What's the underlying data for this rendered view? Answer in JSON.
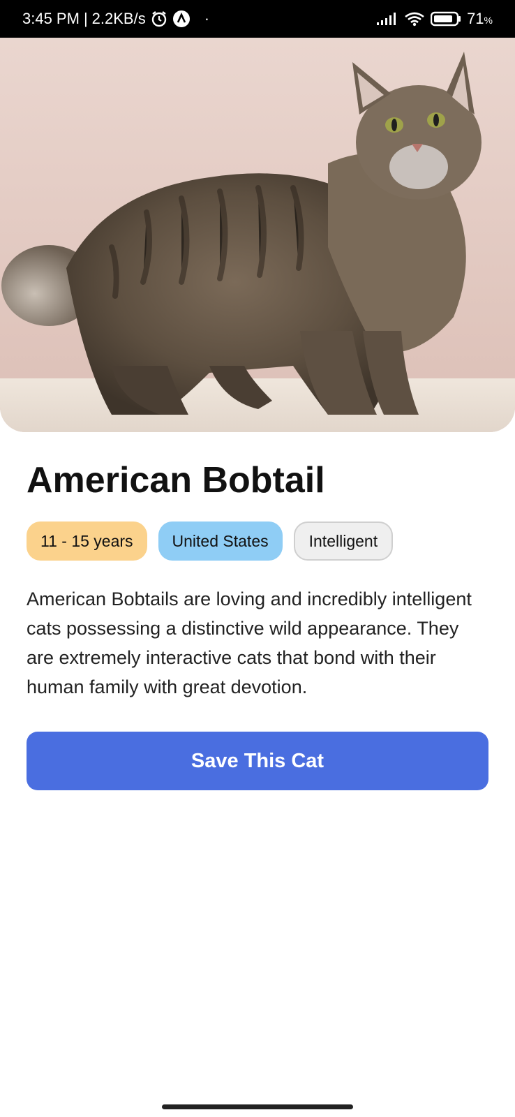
{
  "status_bar": {
    "time": "3:45 PM",
    "separator": "|",
    "net_speed": "2.2KB/s",
    "dot": "·",
    "battery": "71",
    "battery_unit": "%",
    "icons": [
      "alarm-icon",
      "app-notification-icon",
      "signal-icon",
      "wifi-icon",
      "battery-icon"
    ]
  },
  "cat": {
    "name": "American Bobtail",
    "tags": {
      "life_span": "11 - 15 years",
      "origin": "United States",
      "temperament": "Intelligent"
    },
    "description": "American Bobtails are loving and incredibly intelligent cats possessing a distinctive wild appearance. They are extremely interactive cats that bond with their human family with great devotion."
  },
  "actions": {
    "save_label": "Save This Cat"
  },
  "colors": {
    "tag_age": "#fbd28c",
    "tag_origin": "#8fcdf5",
    "tag_temperament": "#efefef",
    "button": "#4a6ee0"
  }
}
